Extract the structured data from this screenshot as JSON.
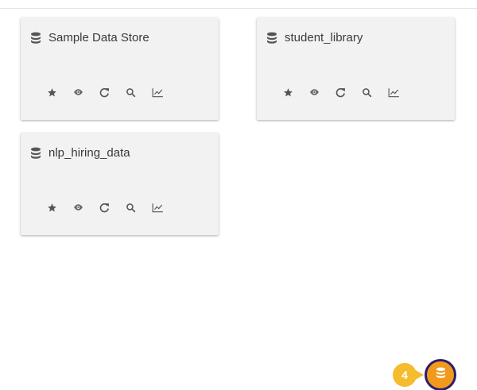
{
  "cards": [
    {
      "title": "Sample Data Store"
    },
    {
      "title": "student_library"
    },
    {
      "title": "nlp_hiring_data"
    }
  ],
  "card_actions": [
    "star-icon",
    "eye-icon",
    "refresh-icon",
    "search-icon",
    "chart-icon"
  ],
  "step_badge": "4",
  "colors": {
    "card_bg": "#f2f2f2",
    "icon": "#5a5a5a",
    "badge": "#f5bc2e",
    "fab": "#f09a1c",
    "fab_ring": "#2a1e6e"
  }
}
